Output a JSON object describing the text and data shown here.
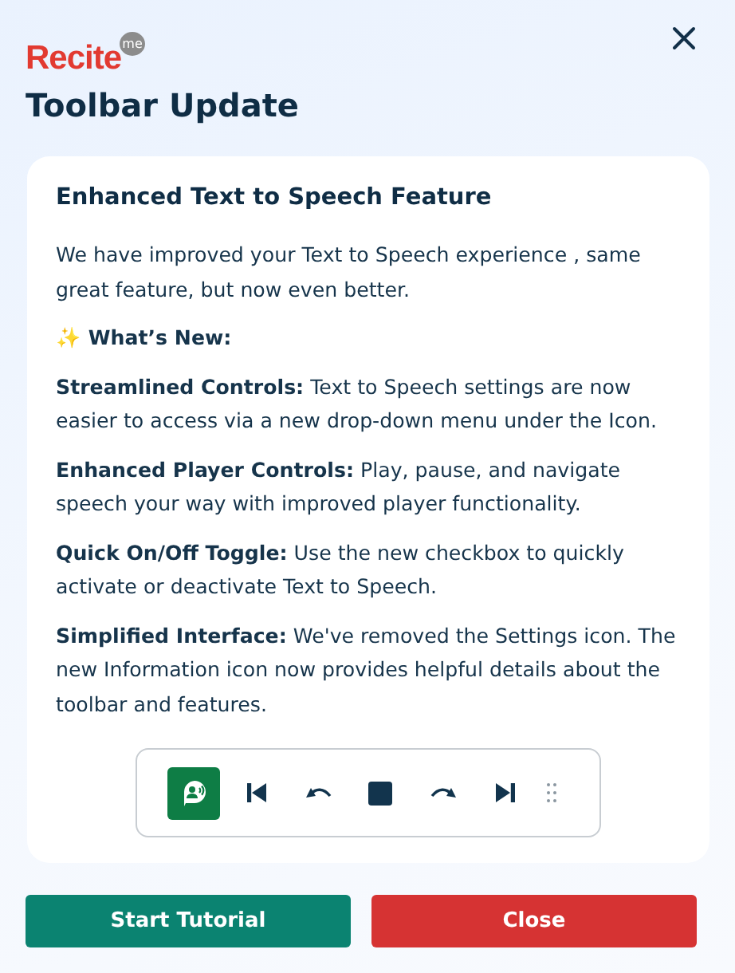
{
  "logo": {
    "name": "Recite",
    "badge": "me"
  },
  "title": "Toolbar Update",
  "card": {
    "heading": "Enhanced Text to Speech Feature",
    "paragraphs": [
      {
        "text": "We have improved your Text to Speech experience , same great feature, but now even better."
      },
      {
        "text": "**✨ What’s New:**"
      },
      {
        "text": "**Streamlined Controls:** Text to Speech settings are now easier to access via a new drop-down menu under the Icon."
      },
      {
        "text": "**Enhanced Player Controls:** Play, pause, and navigate speech your way with improved player functionality."
      },
      {
        "text": "**Quick On/Off Toggle:** Use the new checkbox to quickly activate or deactivate Text to Speech."
      },
      {
        "text": "**Simplified Interface:** We've removed the Settings icon. The new Information icon now provides helpful details about the toolbar and features."
      }
    ],
    "toolbar": [
      {
        "kind": "speech",
        "selected": true
      },
      {
        "kind": "previous",
        "selected": false
      },
      {
        "kind": "rewind",
        "selected": false
      },
      {
        "kind": "stop",
        "selected": false
      },
      {
        "kind": "forward",
        "selected": false
      },
      {
        "kind": "next",
        "selected": false
      },
      {
        "kind": "grip",
        "selected": false
      }
    ]
  },
  "buttons": [
    {
      "label": "Start Tutorial",
      "kind": "primary"
    },
    {
      "label": "Close",
      "kind": "danger"
    }
  ]
}
